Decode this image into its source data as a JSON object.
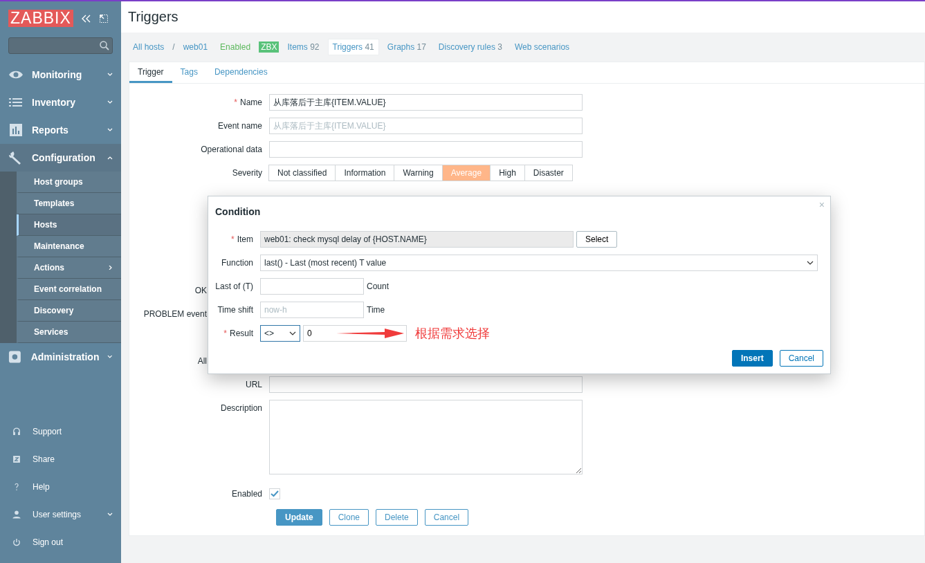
{
  "sidebar": {
    "logo": "ZABBIX",
    "menu": [
      {
        "label": "Monitoring",
        "expanded": false
      },
      {
        "label": "Inventory",
        "expanded": false
      },
      {
        "label": "Reports",
        "expanded": false
      },
      {
        "label": "Configuration",
        "expanded": true,
        "children": [
          {
            "label": "Host groups",
            "selected": false,
            "submenu": false
          },
          {
            "label": "Templates",
            "selected": false,
            "submenu": false
          },
          {
            "label": "Hosts",
            "selected": true,
            "submenu": false
          },
          {
            "label": "Maintenance",
            "selected": false,
            "submenu": false
          },
          {
            "label": "Actions",
            "selected": false,
            "submenu": true
          },
          {
            "label": "Event correlation",
            "selected": false,
            "submenu": false
          },
          {
            "label": "Discovery",
            "selected": false,
            "submenu": false
          },
          {
            "label": "Services",
            "selected": false,
            "submenu": false
          }
        ]
      },
      {
        "label": "Administration",
        "expanded": false
      }
    ],
    "bottom": [
      {
        "label": "Support",
        "submenu": false
      },
      {
        "label": "Share",
        "submenu": false
      },
      {
        "label": "Help",
        "submenu": false
      },
      {
        "label": "User settings",
        "submenu": true
      },
      {
        "label": "Sign out",
        "submenu": false
      }
    ]
  },
  "header": {
    "title": "Triggers"
  },
  "host_nav": {
    "breadcrumbs": [
      "All hosts",
      "web01"
    ],
    "separator": "/",
    "status": "Enabled",
    "badge": "ZBX",
    "tabs": [
      {
        "label": "Items",
        "count": "92",
        "selected": false
      },
      {
        "label": "Triggers",
        "count": "41",
        "selected": true
      },
      {
        "label": "Graphs",
        "count": "17",
        "selected": false
      },
      {
        "label": "Discovery rules",
        "count": "3",
        "selected": false
      },
      {
        "label": "Web scenarios",
        "selected": false
      }
    ]
  },
  "form_tabs": [
    {
      "label": "Trigger",
      "selected": true
    },
    {
      "label": "Tags",
      "selected": false
    },
    {
      "label": "Dependencies",
      "selected": false
    }
  ],
  "form": {
    "rows": [
      {
        "kind": "text",
        "label": "Name",
        "required_mark": "*",
        "value": "从库落后于主库{ITEM.VALUE}"
      },
      {
        "kind": "text",
        "label": "Event name",
        "placeholder": "从库落后于主库{ITEM.VALUE}"
      },
      {
        "kind": "text",
        "label": "Operational data"
      },
      {
        "kind": "severity",
        "label": "Severity",
        "options": [
          {
            "label": "Not classified",
            "selected": false
          },
          {
            "label": "Information",
            "selected": false
          },
          {
            "label": "Warning",
            "selected": false
          },
          {
            "label": "Average",
            "selected": true
          },
          {
            "label": "High",
            "selected": false
          },
          {
            "label": "Disaster",
            "selected": false
          }
        ]
      },
      {
        "kind": "covered",
        "label": "OK"
      },
      {
        "kind": "covered",
        "label": "PROBLEM event"
      },
      {
        "kind": "covered",
        "label": "All"
      },
      {
        "kind": "text",
        "label": "URL"
      },
      {
        "kind": "textarea",
        "label": "Description"
      },
      {
        "kind": "checkbox",
        "label": "Enabled",
        "checked": true
      }
    ],
    "buttons": [
      {
        "label": "Update",
        "primary": true
      },
      {
        "label": "Clone",
        "primary": false
      },
      {
        "label": "Delete",
        "primary": false
      },
      {
        "label": "Cancel",
        "primary": false
      }
    ]
  },
  "dialog": {
    "title": "Condition",
    "close": "×",
    "item": {
      "label": "Item",
      "required_mark": "*",
      "value": "web01: check mysql delay of {HOST.NAME}",
      "button": "Select"
    },
    "function": {
      "label": "Function",
      "value": "last() - Last (most recent) T value"
    },
    "last_of": {
      "label": "Last of (T)",
      "unit": "Count"
    },
    "time_shift": {
      "label": "Time shift",
      "placeholder": "now-h",
      "unit": "Time"
    },
    "result": {
      "label": "Result",
      "required_mark": "*",
      "operator": "<>",
      "value": "0"
    },
    "annotation": "根据需求选择",
    "buttons": [
      {
        "label": "Insert",
        "primary": true
      },
      {
        "label": "Cancel",
        "primary": false
      }
    ]
  }
}
